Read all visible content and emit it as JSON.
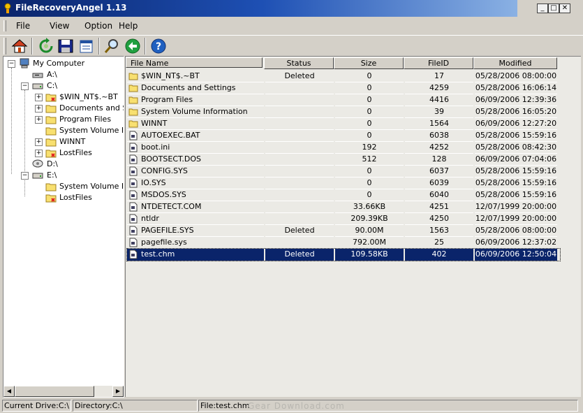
{
  "window": {
    "title": "FileRecoveryAngel 1.13"
  },
  "menu": [
    "File",
    "View",
    "Option",
    "Help"
  ],
  "toolbar": [
    "home-icon",
    "refresh-icon",
    "save-icon",
    "properties-icon",
    "search-icon",
    "back-icon",
    "help-icon"
  ],
  "tree": {
    "root": "My Computer",
    "drive_a": "A:\\",
    "drive_c": "C:\\",
    "c_items": [
      "$WIN_NT$.~BT",
      "Documents and Se",
      "Program Files",
      "System Volume Infc",
      "WINNT",
      "LostFiles"
    ],
    "drive_d": "D:\\",
    "drive_e": "E:\\",
    "e_items": [
      "System Volume Infc",
      "LostFiles"
    ]
  },
  "columns": [
    "File Name",
    "Status",
    "Size",
    "FileID",
    "Modified"
  ],
  "files": [
    {
      "name": "$WIN_NT$.~BT",
      "status": "Deleted",
      "size": "0",
      "id": "17",
      "modified": "05/28/2006 08:00:00",
      "type": "folder"
    },
    {
      "name": "Documents and Settings",
      "status": "",
      "size": "0",
      "id": "4259",
      "modified": "05/28/2006 16:06:14",
      "type": "folder"
    },
    {
      "name": "Program Files",
      "status": "",
      "size": "0",
      "id": "4416",
      "modified": "06/09/2006 12:39:36",
      "type": "folder"
    },
    {
      "name": "System Volume Information",
      "status": "",
      "size": "0",
      "id": "39",
      "modified": "05/28/2006 16:05:20",
      "type": "folder"
    },
    {
      "name": "WINNT",
      "status": "",
      "size": "0",
      "id": "1564",
      "modified": "06/09/2006 12:27:20",
      "type": "folder"
    },
    {
      "name": "AUTOEXEC.BAT",
      "status": "",
      "size": "0",
      "id": "6038",
      "modified": "05/28/2006 15:59:16",
      "type": "file"
    },
    {
      "name": "boot.ini",
      "status": "",
      "size": "192",
      "id": "4252",
      "modified": "05/28/2006 08:42:30",
      "type": "file"
    },
    {
      "name": "BOOTSECT.DOS",
      "status": "",
      "size": "512",
      "id": "128",
      "modified": "06/09/2006 07:04:06",
      "type": "file"
    },
    {
      "name": "CONFIG.SYS",
      "status": "",
      "size": "0",
      "id": "6037",
      "modified": "05/28/2006 15:59:16",
      "type": "file"
    },
    {
      "name": "IO.SYS",
      "status": "",
      "size": "0",
      "id": "6039",
      "modified": "05/28/2006 15:59:16",
      "type": "file"
    },
    {
      "name": "MSDOS.SYS",
      "status": "",
      "size": "0",
      "id": "6040",
      "modified": "05/28/2006 15:59:16",
      "type": "file"
    },
    {
      "name": "NTDETECT.COM",
      "status": "",
      "size": "33.66KB",
      "id": "4251",
      "modified": "12/07/1999 20:00:00",
      "type": "file"
    },
    {
      "name": "ntldr",
      "status": "",
      "size": "209.39KB",
      "id": "4250",
      "modified": "12/07/1999 20:00:00",
      "type": "file"
    },
    {
      "name": "PAGEFILE.SYS",
      "status": "Deleted",
      "size": "90.00M",
      "id": "1563",
      "modified": "05/28/2006 08:00:00",
      "type": "file"
    },
    {
      "name": "pagefile.sys",
      "status": "",
      "size": "792.00M",
      "id": "25",
      "modified": "06/09/2006 12:37:02",
      "type": "file"
    },
    {
      "name": "test.chm",
      "status": "Deleted",
      "size": "109.58KB",
      "id": "402",
      "modified": "06/09/2006 12:50:04",
      "type": "file",
      "selected": true
    }
  ],
  "status": {
    "drive": "Current Drive:C:\\",
    "directory": "Directory:C:\\",
    "file": "File:test.chm"
  },
  "watermark": "Gear Download.com"
}
